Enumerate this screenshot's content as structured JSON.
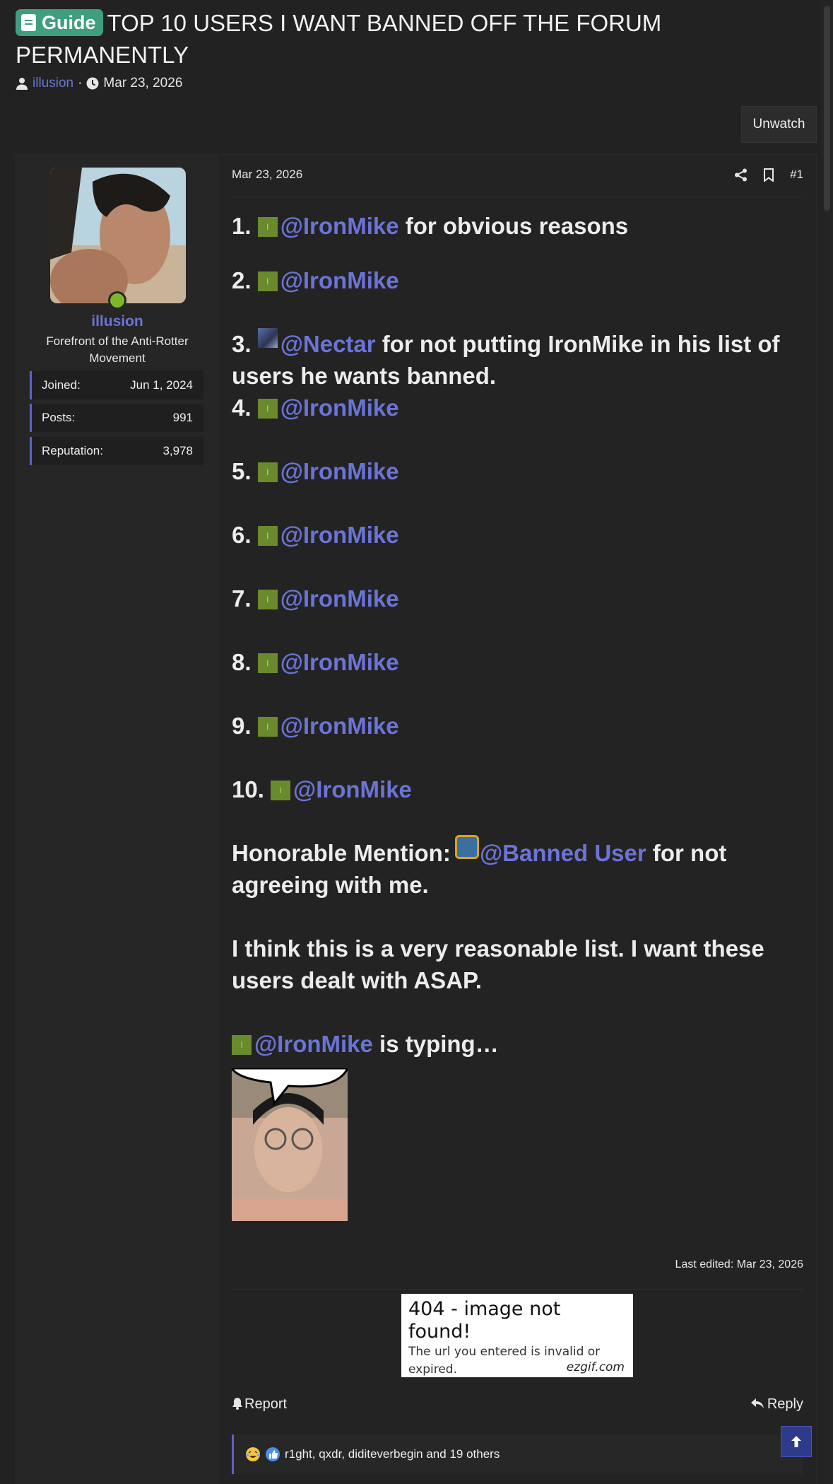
{
  "thread": {
    "prefix_label": "Guide",
    "title": "TOP 10 USERS I WANT BANNED OFF THE FORUM PERMANENTLY",
    "author": "illusion",
    "date": "Mar 23, 2026",
    "meta_sep": "·",
    "unwatch_label": "Unwatch"
  },
  "user": {
    "name": "illusion",
    "title": "Forefront of the Anti-Rotter Movement",
    "stats": [
      {
        "label": "Joined:",
        "value": "Jun 1, 2024"
      },
      {
        "label": "Posts:",
        "value": "991"
      },
      {
        "label": "Reputation:",
        "value": "3,978"
      }
    ]
  },
  "post": {
    "date": "Mar 23, 2026",
    "number": "#1",
    "list": [
      {
        "num": "1.",
        "mention": "@IronMike",
        "suffix": " for obvious reasons",
        "avatar": "green"
      },
      {
        "num": "2.",
        "mention": "@IronMike",
        "suffix": "",
        "avatar": "green"
      },
      {
        "num": "3.",
        "mention": "@Nectar",
        "suffix": " for not putting IronMike in his list of users he wants banned.",
        "avatar": "nectar"
      },
      {
        "num": "4.",
        "mention": "@IronMike",
        "suffix": "",
        "avatar": "green"
      },
      {
        "num": "5.",
        "mention": "@IronMike",
        "suffix": "",
        "avatar": "green"
      },
      {
        "num": "6.",
        "mention": "@IronMike",
        "suffix": "",
        "avatar": "green"
      },
      {
        "num": "7.",
        "mention": "@IronMike",
        "suffix": "",
        "avatar": "green"
      },
      {
        "num": "8.",
        "mention": "@IronMike",
        "suffix": "",
        "avatar": "green"
      },
      {
        "num": "9.",
        "mention": "@IronMike",
        "suffix": "",
        "avatar": "green"
      },
      {
        "num": "10.",
        "mention": "@IronMike",
        "suffix": "",
        "avatar": "green"
      }
    ],
    "honorable_prefix": "Honorable Mention: ",
    "honorable_mention": "@Banned User",
    "honorable_suffix": " for not agreeing with me.",
    "closing": "I think this is a very reasonable list. I want these users dealt with ASAP.",
    "typing_mention": "@IronMike",
    "typing_suffix": " is typing…",
    "avatar_letter": "I",
    "last_edited": "Last edited: Mar 23, 2026"
  },
  "signature": {
    "heading": "404 - image not found!",
    "text": "The url you entered is invalid or expired.",
    "credit": "ezgif.com"
  },
  "footer": {
    "report_label": "Report",
    "reply_label": "Reply",
    "reactions_text": "r1ght, qxdr, diditeverbegin and 19 others"
  },
  "colors": {
    "link": "#6b74d6",
    "prefix_bg": "#3f9e7d",
    "online": "#7fb52a",
    "accent_bar": "#5c65c8"
  }
}
